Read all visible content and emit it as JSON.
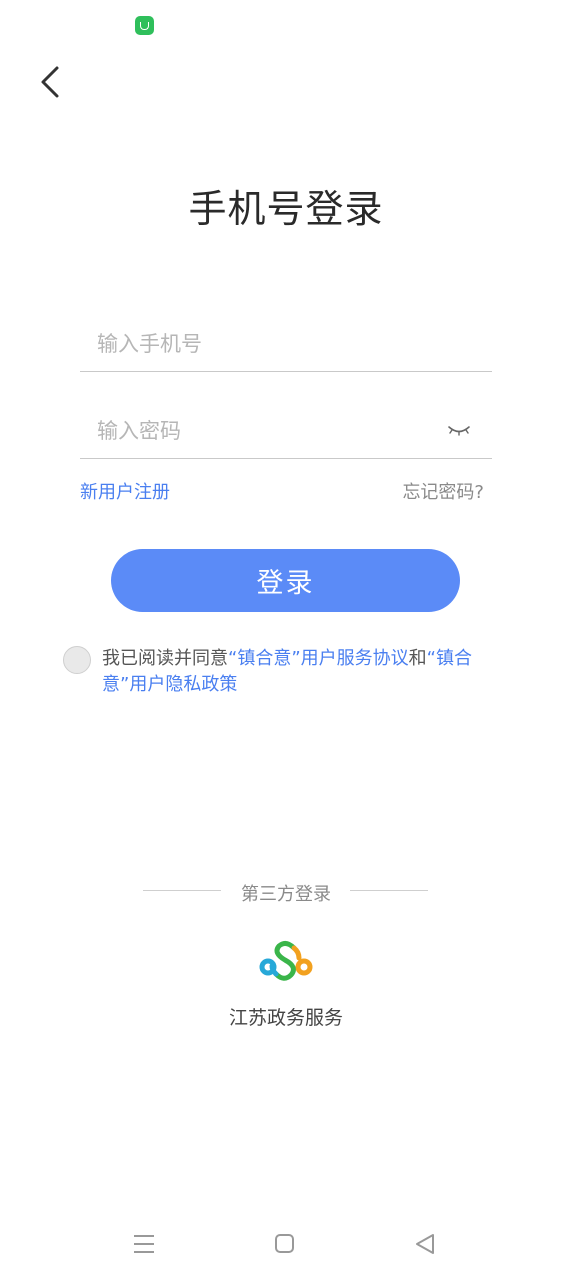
{
  "header": {
    "title": "手机号登录"
  },
  "form": {
    "phone_placeholder": "输入手机号",
    "phone_value": "",
    "password_placeholder": "输入密码",
    "password_value": "",
    "register_label": "新用户注册",
    "forgot_label": "忘记密码?",
    "login_label": "登录"
  },
  "agreement": {
    "checked": false,
    "prefix": "我已阅读并同意",
    "user_agreement": "“镇合意”用户服务协议",
    "conjunction": "和",
    "privacy_policy": "“镇合意”用户隐私政策"
  },
  "third_party": {
    "heading": "第三方登录",
    "providers": [
      {
        "label": "江苏政务服务",
        "icon": "jiangsu-gov-service-icon"
      }
    ]
  },
  "colors": {
    "accent": "#5b8bf7",
    "link": "#4a7ff0",
    "status_app_icon": "#2fbf5b"
  },
  "icons": {
    "back": "chevron-left-icon",
    "password_toggle": "eye-closed-icon",
    "nav_menu": "menu-icon",
    "nav_home": "home-square-icon",
    "nav_back": "triangle-back-icon"
  }
}
